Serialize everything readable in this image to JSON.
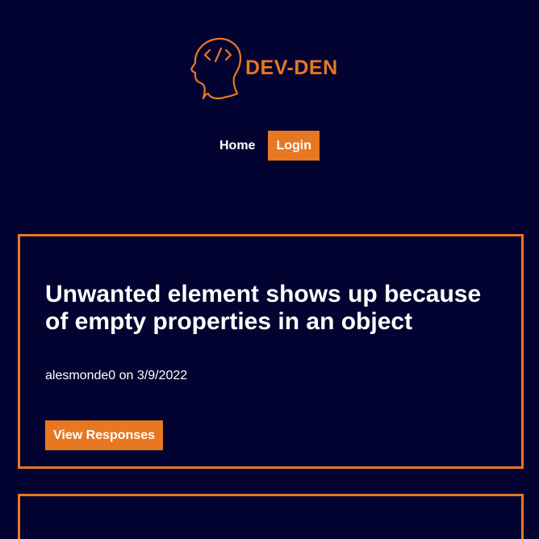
{
  "logo": {
    "text": "DEV-DEN",
    "icon": "head-code-icon"
  },
  "nav": {
    "home_label": "Home",
    "login_label": "Login"
  },
  "posts": [
    {
      "title": "Unwanted element shows up because of empty properties in an object",
      "meta": "alesmonde0 on 3/9/2022",
      "button_label": "View Responses"
    }
  ],
  "colors": {
    "background": "#030331",
    "accent": "#e87722",
    "text": "#ffffff"
  }
}
